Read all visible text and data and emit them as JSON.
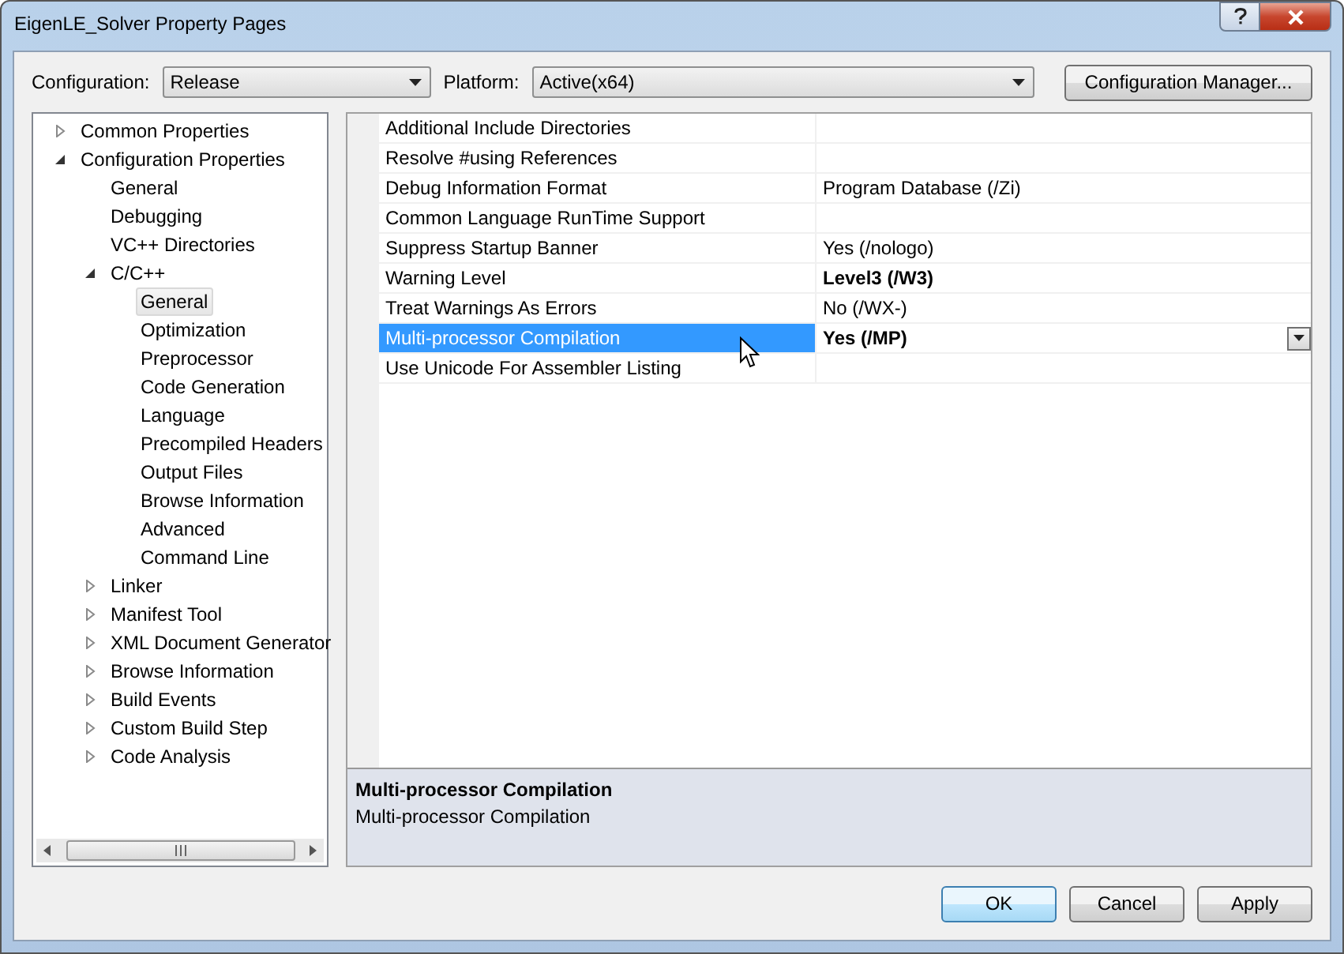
{
  "window": {
    "title": "EigenLE_Solver Property Pages"
  },
  "toolbar": {
    "configuration_label": "Configuration:",
    "configuration_value": "Release",
    "platform_label": "Platform:",
    "platform_value": "Active(x64)",
    "manager_button": "Configuration Manager..."
  },
  "tree": [
    {
      "label": "Common Properties",
      "expanded": false,
      "selected": false
    },
    {
      "label": "Configuration Properties",
      "expanded": true,
      "selected": false,
      "children": [
        {
          "label": "General",
          "selected": false
        },
        {
          "label": "Debugging",
          "selected": false
        },
        {
          "label": "VC++ Directories",
          "selected": false
        },
        {
          "label": "C/C++",
          "expanded": true,
          "selected": false,
          "children": [
            {
              "label": "General",
              "selected": true
            },
            {
              "label": "Optimization",
              "selected": false
            },
            {
              "label": "Preprocessor",
              "selected": false
            },
            {
              "label": "Code Generation",
              "selected": false
            },
            {
              "label": "Language",
              "selected": false
            },
            {
              "label": "Precompiled Headers",
              "selected": false
            },
            {
              "label": "Output Files",
              "selected": false
            },
            {
              "label": "Browse Information",
              "selected": false
            },
            {
              "label": "Advanced",
              "selected": false
            },
            {
              "label": "Command Line",
              "selected": false
            }
          ]
        },
        {
          "label": "Linker",
          "expanded": false,
          "selected": false
        },
        {
          "label": "Manifest Tool",
          "expanded": false,
          "selected": false
        },
        {
          "label": "XML Document Generator",
          "expanded": false,
          "selected": false
        },
        {
          "label": "Browse Information",
          "expanded": false,
          "selected": false
        },
        {
          "label": "Build Events",
          "expanded": false,
          "selected": false
        },
        {
          "label": "Custom Build Step",
          "expanded": false,
          "selected": false
        },
        {
          "label": "Code Analysis",
          "expanded": false,
          "selected": false
        }
      ]
    }
  ],
  "properties": [
    {
      "name": "Additional Include Directories",
      "selected": false
    },
    {
      "name": "Resolve #using References",
      "selected": false
    },
    {
      "name": "Debug Information Format",
      "value": "Program Database (/Zi)",
      "bold": false,
      "selected": false
    },
    {
      "name": "Common Language RunTime Support",
      "selected": false
    },
    {
      "name": "Suppress Startup Banner",
      "value": "Yes (/nologo)",
      "bold": false,
      "selected": false
    },
    {
      "name": "Warning Level",
      "value": "Level3 (/W3)",
      "bold": true,
      "selected": false
    },
    {
      "name": "Treat Warnings As Errors",
      "value": "No (/WX-)",
      "bold": false,
      "selected": false
    },
    {
      "name": "Multi-processor Compilation",
      "value": "Yes (/MP)",
      "bold": true,
      "selected": true
    },
    {
      "name": "Use Unicode For Assembler Listing",
      "selected": false
    }
  ],
  "description": {
    "title": "Multi-processor Compilation",
    "text": "Multi-processor Compilation"
  },
  "buttons": [
    {
      "label": "OK",
      "default": true
    },
    {
      "label": "Cancel",
      "default": false
    },
    {
      "label": "Apply",
      "default": false
    }
  ]
}
